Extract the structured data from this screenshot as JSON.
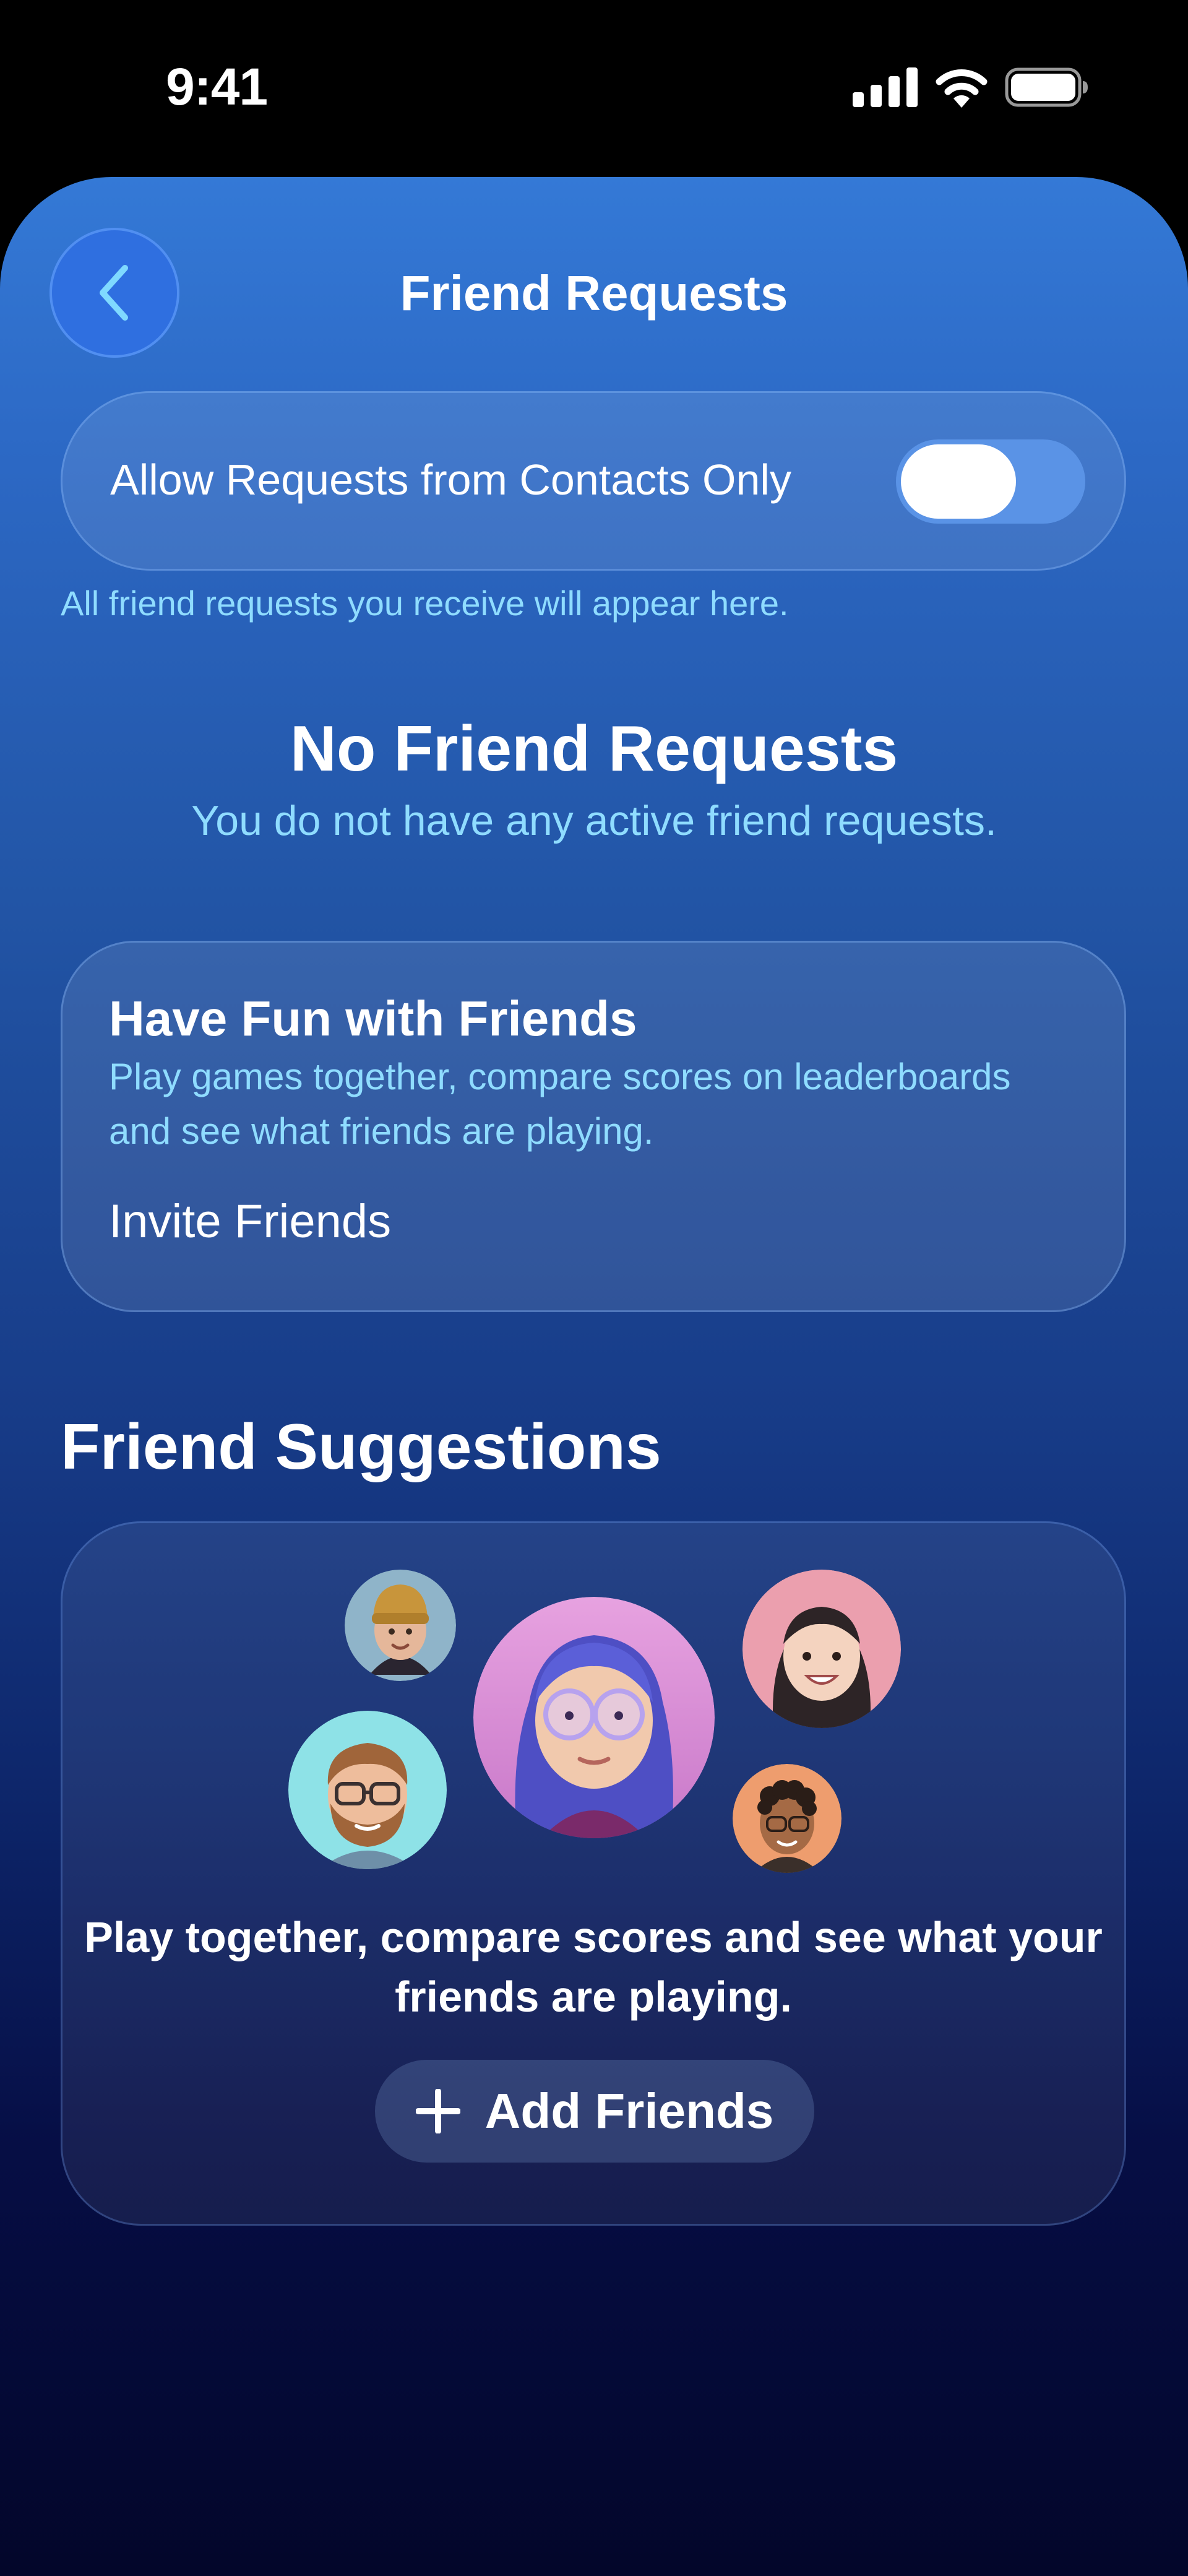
{
  "status_bar": {
    "time": "9:41",
    "signal_icon": "cellular-signal-icon",
    "wifi_icon": "wifi-icon",
    "battery_icon": "battery-icon"
  },
  "nav": {
    "title": "Friend Requests",
    "back_icon": "chevron-left-icon"
  },
  "settings": {
    "toggle_label": "Allow Requests from Contacts Only",
    "toggle_on": false,
    "footnote": "All friend requests you receive will appear here."
  },
  "empty_state": {
    "title": "No Friend Requests",
    "subtitle": "You do not have any active friend requests."
  },
  "fun_card": {
    "title": "Have Fun with Friends",
    "description": "Play games together, compare scores on leaderboards and see what friends are playing.",
    "link_label": "Invite Friends"
  },
  "suggestions": {
    "section_title": "Friend Suggestions",
    "text": "Play together, compare scores and see what your friends are playing.",
    "button_label": "Add Friends",
    "button_icon": "plus-icon"
  },
  "colors": {
    "accent_blue": "#2f6fe0",
    "secondary_text": "#8fdcff",
    "sheet_top": "#3479d6",
    "sheet_bottom": "#03062a"
  }
}
